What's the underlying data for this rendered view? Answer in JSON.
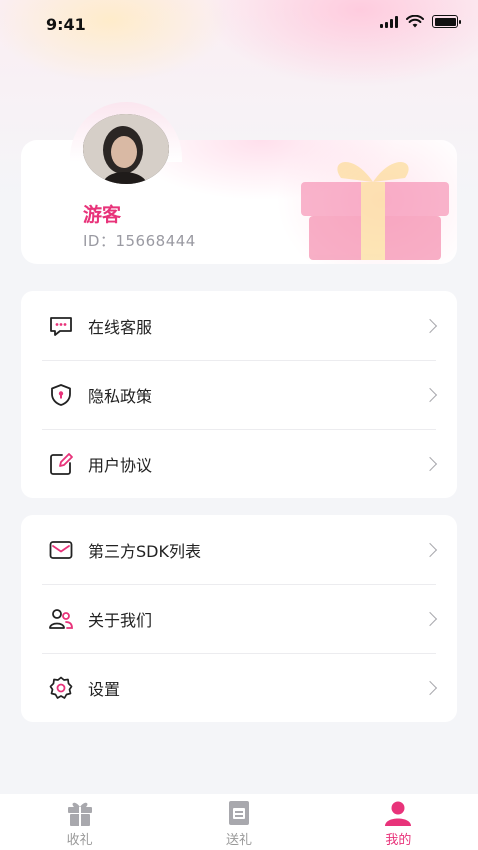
{
  "status_bar": {
    "time": "9:41"
  },
  "profile": {
    "name": "游客",
    "id_text": "ID：15668444"
  },
  "menu_group_1": [
    {
      "label": "在线客服",
      "icon": "chat-bubble-icon"
    },
    {
      "label": "隐私政策",
      "icon": "shield-lock-icon"
    },
    {
      "label": "用户协议",
      "icon": "edit-document-icon"
    }
  ],
  "menu_group_2": [
    {
      "label": "第三方SDK列表",
      "icon": "envelope-icon"
    },
    {
      "label": "关于我们",
      "icon": "users-icon"
    },
    {
      "label": "设置",
      "icon": "gear-icon"
    }
  ],
  "tabs": [
    {
      "label": "收礼",
      "icon": "gift-icon",
      "active": false
    },
    {
      "label": "送礼",
      "icon": "gift-card-icon",
      "active": false
    },
    {
      "label": "我的",
      "icon": "user-profile-icon",
      "active": true
    }
  ],
  "colors": {
    "accent": "#e8337a",
    "icon_stroke": "#222222"
  }
}
